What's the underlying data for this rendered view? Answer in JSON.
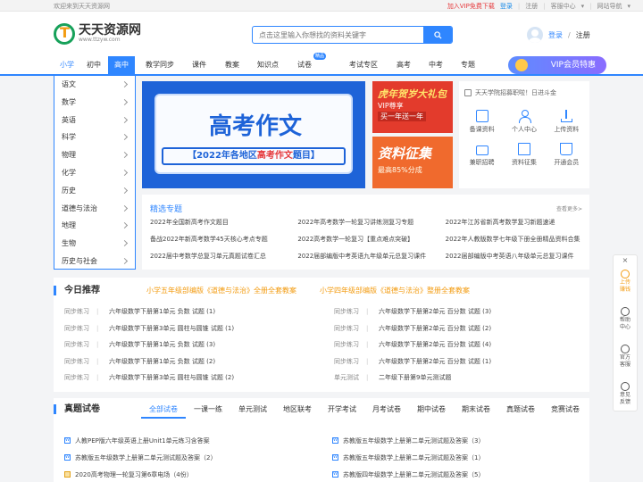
{
  "topbar": {
    "welcome": "欢迎来到天天资源网",
    "vip_download": "加入VIP免费下载",
    "login": "登录",
    "register": "注册",
    "service": "客服中心",
    "site_nav": "网站导航"
  },
  "logo": {
    "title": "天天资源网",
    "subtitle": "www.ttzyw.com"
  },
  "search": {
    "placeholder": "点击这里输入你想找的资料关键字"
  },
  "user": {
    "login": "登录",
    "sep": "/",
    "register": "注册"
  },
  "nav": {
    "stages": [
      "小学",
      "初中",
      "高中"
    ],
    "items": [
      "教学同步",
      "课件",
      "教案",
      "知识点",
      "试卷",
      "考试专区",
      "高考",
      "中考",
      "专题"
    ],
    "badge": "精品",
    "vip": "VIP会员特惠"
  },
  "sidebar": {
    "items": [
      "语文",
      "数学",
      "英语",
      "科学",
      "物理",
      "化学",
      "历史",
      "道德与法治",
      "地理",
      "生物",
      "历史与社会"
    ]
  },
  "banner": {
    "title": "高考作文",
    "subtitle_prefix": "【2022年各地区",
    "subtitle_highlight": "高考作文",
    "subtitle_suffix": "题目】"
  },
  "promos": [
    {
      "title": "虎年贺岁大礼包",
      "line1": "VIP尊享",
      "line2": "买一年送一年"
    },
    {
      "title": "资料征集",
      "line1": "最高85%分成"
    }
  ],
  "quick": {
    "notice": "天天学院招募职啦！日进斗金",
    "items": [
      {
        "icon": "document-icon",
        "label": "备课资料"
      },
      {
        "icon": "person-icon",
        "label": "个人中心"
      },
      {
        "icon": "upload-icon",
        "label": "上传资料"
      },
      {
        "icon": "briefcase-icon",
        "label": "兼职招聘"
      },
      {
        "icon": "folder-icon",
        "label": "资料征集"
      },
      {
        "icon": "shop-icon",
        "label": "开通会员"
      }
    ]
  },
  "special": {
    "title": "精选专题",
    "more": "查看更多>",
    "items": [
      "2022年全国新高考作文题目",
      "2022年高考数学一轮复习讲练测复习专题",
      "2022年江苏省新高考数学复习新题速递",
      "备战2022年新高考数学45天核心考点专题",
      "2022高考数学一轮复习【重点难点突破】",
      "2022年人教版数学七年级下册全册精品资料合集",
      "2022届中考数学总复习单元真题试卷汇总",
      "2022届部编版中考英语九年级单元总复习课件",
      "2022届部编版中考英语八年级单元总复习课件"
    ]
  },
  "recommend": {
    "title": "今日推荐",
    "links": [
      "小学五年级部编版《道德与法治》全册全套教案",
      "小学四年级部编版《道德与法治》整册全套教案"
    ],
    "left": [
      {
        "cat": "同步练习",
        "text": "六年级数学下册第1单元 负数 试题 (1)"
      },
      {
        "cat": "同步练习",
        "text": "六年级数学下册第3单元 圆柱与圆锥 试题 (1)"
      },
      {
        "cat": "同步练习",
        "text": "六年级数学下册第1单元 负数 试题 (3)"
      },
      {
        "cat": "同步练习",
        "text": "六年级数学下册第1单元 负数 试题 (2)"
      },
      {
        "cat": "同步练习",
        "text": "六年级数学下册第3单元 圆柱与圆锥 试题 (2)"
      }
    ],
    "right": [
      {
        "cat": "同步练习",
        "text": "六年级数学下册第2单元 百分数 试题 (3)"
      },
      {
        "cat": "同步练习",
        "text": "六年级数学下册第2单元 百分数 试题 (2)"
      },
      {
        "cat": "同步练习",
        "text": "六年级数学下册第2单元 百分数 试题 (4)"
      },
      {
        "cat": "同步练习",
        "text": "六年级数学下册第2单元 百分数 试题 (1)"
      },
      {
        "cat": "单元测试",
        "text": "二年级下册第9单元测试题"
      }
    ]
  },
  "exam": {
    "title": "真题试卷",
    "tabs": [
      "全部试卷",
      "一课一练",
      "单元测试",
      "地区联考",
      "开学考试",
      "月考试卷",
      "期中试卷",
      "期末试卷",
      "真题试卷",
      "竞赛试卷"
    ],
    "left": [
      {
        "icon": "word",
        "text": "人教PEP版六年级英语上册Unit1单元练习含答案"
      },
      {
        "icon": "word",
        "text": "苏教版五年级数学上册第二单元测试题及答案（2）"
      },
      {
        "icon": "other",
        "text": "2020高考物理一轮复习第6章电场（4份）"
      }
    ],
    "right": [
      {
        "icon": "word",
        "text": "苏教版五年级数学上册第二单元测试题及答案（3）"
      },
      {
        "icon": "word",
        "text": "苏教版五年级数学上册第二单元测试题及答案（1）"
      },
      {
        "icon": "word",
        "text": "苏教版四年级数学上册第二单元测试题及答案（5）"
      }
    ]
  },
  "float": {
    "close": "×",
    "items": [
      {
        "line1": "上传",
        "line2": "赚钱"
      },
      {
        "line1": "帮助",
        "line2": "中心"
      },
      {
        "line1": "官方",
        "line2": "客服"
      },
      {
        "line1": "意见",
        "line2": "反馈"
      }
    ]
  }
}
